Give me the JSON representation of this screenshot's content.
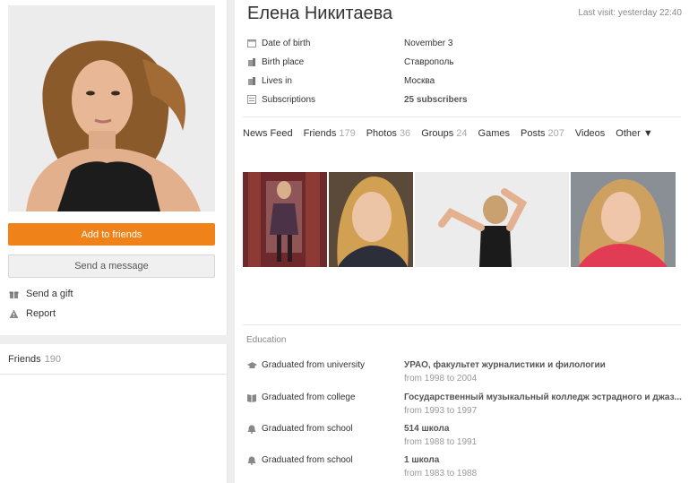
{
  "profile": {
    "name": "Елена Никитаева",
    "last_visit": "Last visit: yesterday 22:40"
  },
  "actions": {
    "add_friend": "Add to friends",
    "send_message": "Send a message",
    "send_gift": "Send a gift",
    "report": "Report"
  },
  "sidebar_friends": {
    "label": "Friends",
    "count": "190"
  },
  "info": [
    {
      "label": "Date of birth",
      "value": "November 3",
      "icon": "calendar-icon"
    },
    {
      "label": "Birth place",
      "value": "Ставрополь",
      "icon": "building-icon"
    },
    {
      "label": "Lives in",
      "value": "Москва",
      "icon": "building-icon"
    },
    {
      "label": "Subscriptions",
      "value": "25 subscribers",
      "icon": "subscriptions-icon"
    }
  ],
  "tabs": [
    {
      "label": "News Feed",
      "count": ""
    },
    {
      "label": "Friends",
      "count": "179"
    },
    {
      "label": "Photos",
      "count": "36"
    },
    {
      "label": "Groups",
      "count": "24"
    },
    {
      "label": "Games",
      "count": ""
    },
    {
      "label": "Posts",
      "count": "207"
    },
    {
      "label": "Videos",
      "count": ""
    },
    {
      "label": "Other ▼",
      "count": ""
    }
  ],
  "education": {
    "title": "Education",
    "items": [
      {
        "type": "Graduated from university",
        "institution": "УРАО, факультет журналистики и филологии",
        "years": "from 1998 to 2004",
        "icon": "graduation-cap-icon"
      },
      {
        "type": "Graduated from college",
        "institution": "Государственный музыкальный колледж эстрадного и джаз...",
        "years": "from 1993 to 1997",
        "icon": "book-icon"
      },
      {
        "type": "Graduated from school",
        "institution": "514 школа",
        "years": "from 1988 to 1991",
        "icon": "bell-icon"
      },
      {
        "type": "Graduated from school",
        "institution": "1 школа",
        "years": "from 1983 to 1988",
        "icon": "bell-icon"
      }
    ]
  },
  "colors": {
    "accent": "#ef8319",
    "muted": "#999999"
  }
}
